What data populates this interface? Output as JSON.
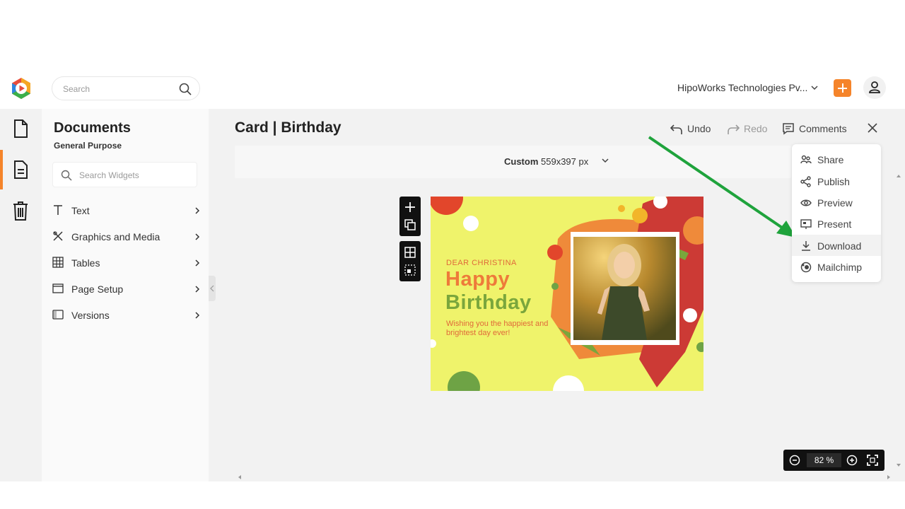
{
  "header": {
    "search_placeholder": "Search",
    "organization": "HipoWorks Technologies Pv..."
  },
  "sidebar": {
    "title": "Documents",
    "subtitle": "General Purpose",
    "widget_search_placeholder": "Search Widgets",
    "items": [
      {
        "label": "Text",
        "icon": "text-icon"
      },
      {
        "label": "Graphics and Media",
        "icon": "graphics-icon"
      },
      {
        "label": "Tables",
        "icon": "table-icon"
      },
      {
        "label": "Page Setup",
        "icon": "page-setup-icon"
      },
      {
        "label": "Versions",
        "icon": "versions-icon"
      }
    ]
  },
  "document": {
    "title": "Card | Birthday",
    "undo_label": "Undo",
    "redo_label": "Redo",
    "comments_label": "Comments",
    "size_preset": "Custom",
    "size_value": "559x397 px"
  },
  "card": {
    "greeting": "DEAR CHRISTINA",
    "line1": "Happy",
    "line2": "Birthday",
    "message": "Wishing you the happiest and brightest day ever!"
  },
  "menu": {
    "items": [
      {
        "label": "Share",
        "icon": "share-users-icon"
      },
      {
        "label": "Publish",
        "icon": "publish-icon"
      },
      {
        "label": "Preview",
        "icon": "eye-icon"
      },
      {
        "label": "Present",
        "icon": "present-icon"
      },
      {
        "label": "Download",
        "icon": "download-icon",
        "highlighted": true
      },
      {
        "label": "Mailchimp",
        "icon": "mailchimp-icon"
      }
    ]
  },
  "zoom": {
    "value": "82",
    "unit": "%"
  },
  "colors": {
    "accent": "#f5842a",
    "arrow": "#1fa33c",
    "card_bg": "#eff36b"
  }
}
